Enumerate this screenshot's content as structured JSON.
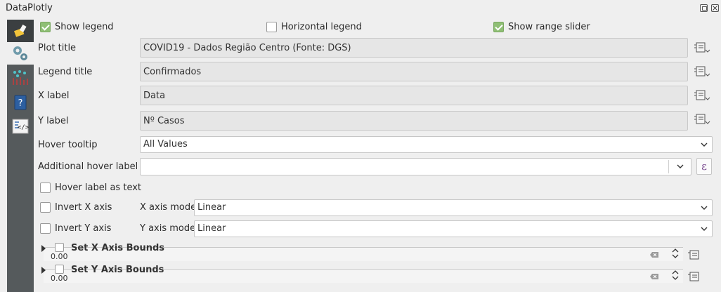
{
  "window": {
    "title": "DataPlotly"
  },
  "sidebar": {
    "items": [
      {
        "name": "plot-icon"
      },
      {
        "name": "settings-icon"
      },
      {
        "name": "chart-icon"
      },
      {
        "name": "help-icon"
      },
      {
        "name": "code-icon"
      }
    ]
  },
  "options": {
    "show_legend": {
      "label": "Show legend",
      "checked": true
    },
    "horizontal_legend": {
      "label": "Horizontal legend",
      "checked": false
    },
    "show_range_slider": {
      "label": "Show range slider",
      "checked": true
    }
  },
  "fields": {
    "plot_title": {
      "label": "Plot title",
      "value": "COVID19 - Dados Região Centro (Fonte: DGS)"
    },
    "legend_title": {
      "label": "Legend title",
      "value": "Confirmados"
    },
    "x_label": {
      "label": "X label",
      "value": "Data"
    },
    "y_label": {
      "label": "Y label",
      "value": "Nº Casos"
    },
    "hover_tooltip": {
      "label": "Hover tooltip",
      "value": "All Values"
    },
    "additional_hover_label": {
      "label": "Additional hover label",
      "value": "",
      "expr_button": "ε"
    }
  },
  "hover_label_as_text": {
    "label": "Hover label as text",
    "checked": false
  },
  "axes": {
    "invert_x": {
      "label": "Invert X axis",
      "checked": false
    },
    "x_mode": {
      "label": "X axis mode",
      "value": "Linear"
    },
    "invert_y": {
      "label": "Invert Y axis",
      "checked": false
    },
    "y_mode": {
      "label": "Y axis mode",
      "value": "Linear"
    }
  },
  "groups": {
    "x_bounds": {
      "title": "Set X Axis Bounds",
      "value": "0.00"
    },
    "y_bounds": {
      "title": "Set Y Axis Bounds",
      "value": "0.00"
    }
  }
}
